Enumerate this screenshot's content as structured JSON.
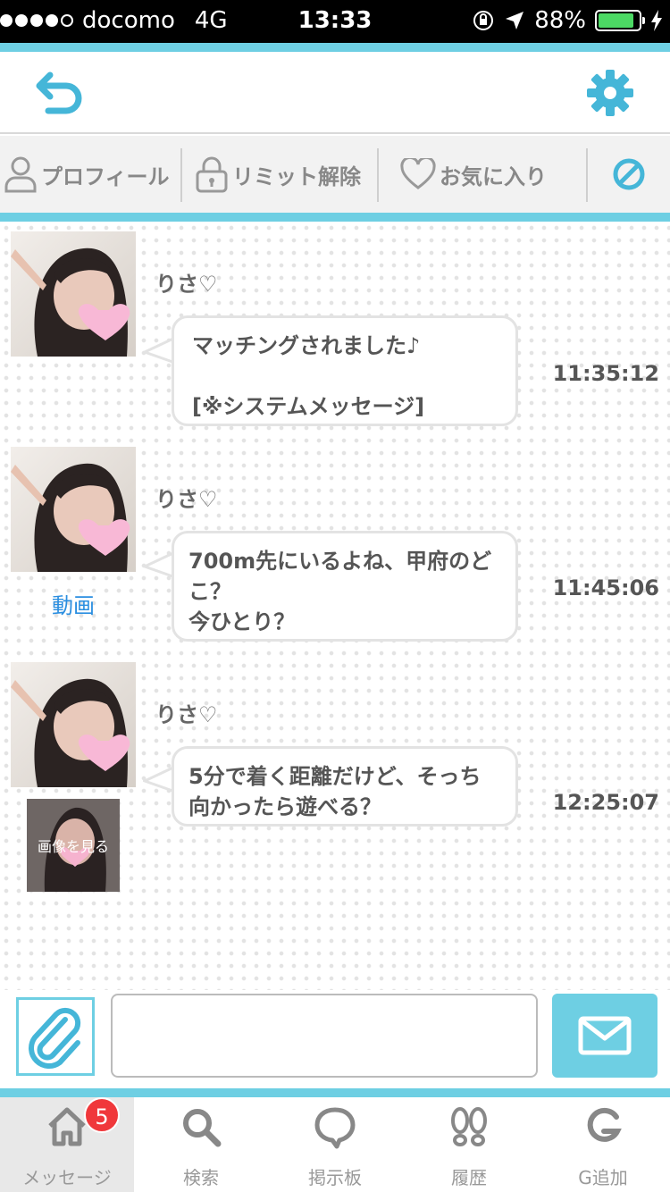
{
  "status_bar": {
    "carrier": "docomo",
    "network": "4G",
    "time": "13:33",
    "battery_percent": "88%",
    "battery_level": 0.88
  },
  "action_bar": {
    "profile_label": "プロフィール",
    "limit_label": "リミット解除",
    "favorite_label": "お気に入り"
  },
  "messages": [
    {
      "sender": "りさ♡",
      "text": "マッチングされました♪\n\n[※システムメッセージ]",
      "time": "11:35:12"
    },
    {
      "sender": "りさ♡",
      "text": "700m先にいるよね、甲府のどこ？\n今ひとり？",
      "time": "11:45:06",
      "extra_link": "動画"
    },
    {
      "sender": "りさ♡",
      "text": "5分で着く距離だけど、そっち向かったら遊べる？",
      "time": "12:25:07",
      "image_label": "画像を見る"
    }
  ],
  "composer": {
    "input_value": ""
  },
  "tab_bar": {
    "tabs": [
      {
        "label": "メッセージ",
        "badge": "5"
      },
      {
        "label": "検索"
      },
      {
        "label": "掲示板"
      },
      {
        "label": "履歴"
      },
      {
        "label": "G追加"
      }
    ]
  },
  "colors": {
    "accent": "#6ecfe3",
    "badge": "#f0383b",
    "link": "#2a8ee0"
  }
}
